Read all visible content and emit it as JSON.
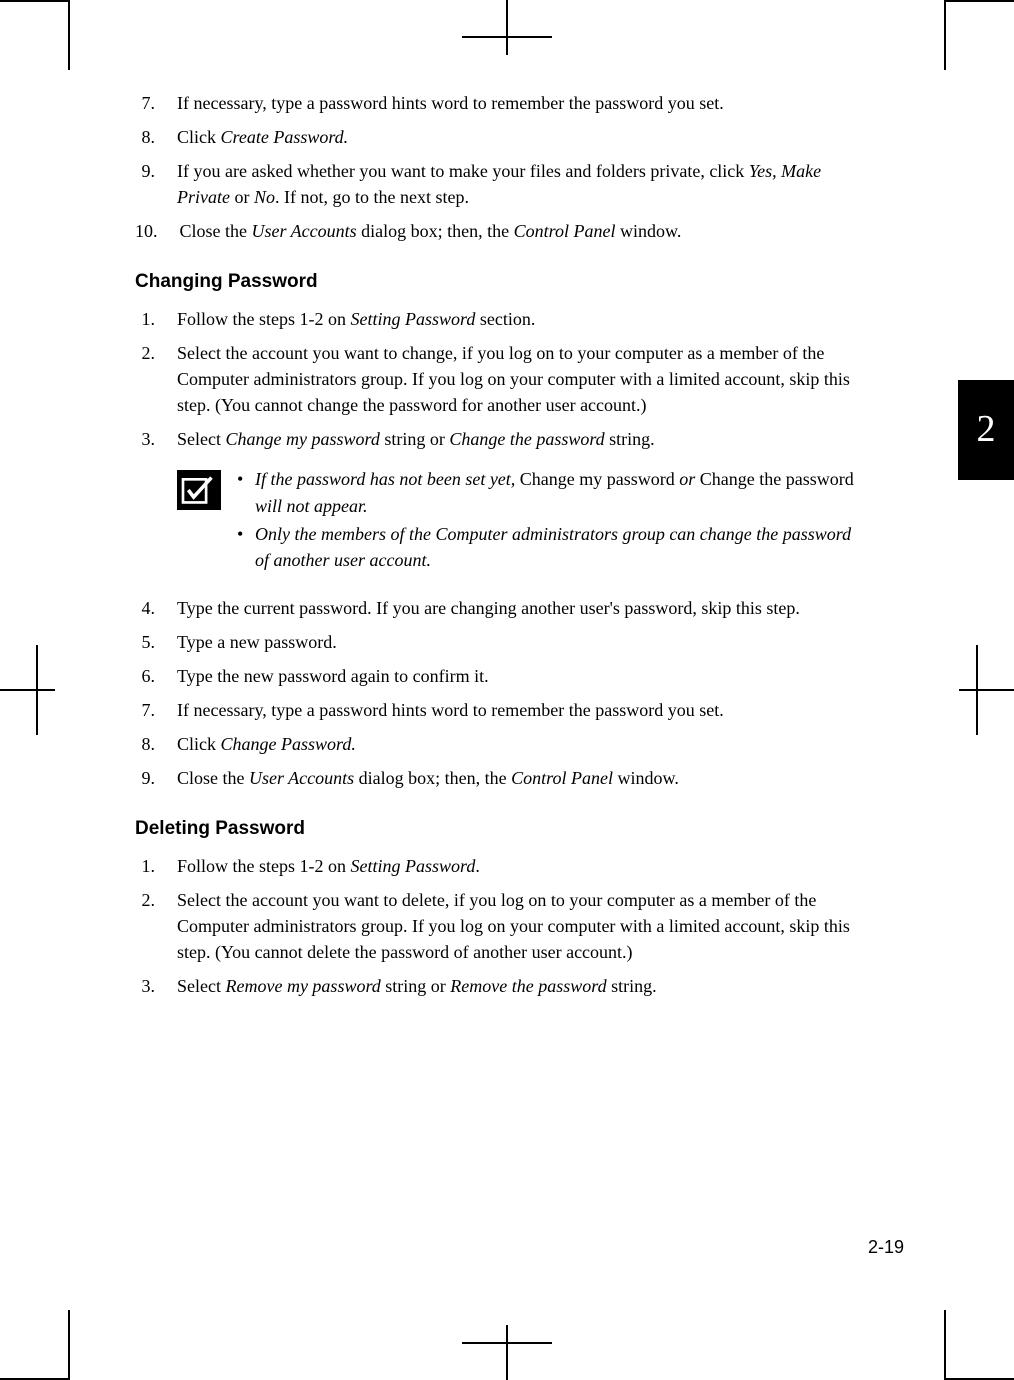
{
  "tab_number": "2",
  "page_number": "2-19",
  "section1": {
    "items": [
      {
        "n": "7.",
        "runs": [
          {
            "t": "If necessary, type a password hints word to remember the password you set."
          }
        ]
      },
      {
        "n": "8.",
        "runs": [
          {
            "t": "Click "
          },
          {
            "t": "Create Password.",
            "i": true
          }
        ]
      },
      {
        "n": "9.",
        "runs": [
          {
            "t": "If you are asked whether you want to make your files and folders private, click "
          },
          {
            "t": "Yes, Make Private",
            "i": true
          },
          {
            "t": " or "
          },
          {
            "t": "No",
            "i": true
          },
          {
            "t": ". If not, go to the next step."
          }
        ]
      },
      {
        "n": "10.",
        "runs": [
          {
            "t": "Close the "
          },
          {
            "t": "User Accounts",
            "i": true
          },
          {
            "t": " dialog box; then, the "
          },
          {
            "t": "Control Panel",
            "i": true
          },
          {
            "t": " window."
          }
        ]
      }
    ]
  },
  "section2": {
    "heading": "Changing Password",
    "items_a": [
      {
        "n": "1.",
        "runs": [
          {
            "t": "Follow the steps 1-2 on "
          },
          {
            "t": "Setting Password",
            "i": true
          },
          {
            "t": " section."
          }
        ]
      },
      {
        "n": "2.",
        "runs": [
          {
            "t": "Select the account you want to change, if you log on to your computer as a member of the Computer administrators group.  If you log on your computer with a limited account, skip this step. (You cannot change the password for another user account.)"
          }
        ]
      },
      {
        "n": "3.",
        "runs": [
          {
            "t": "Select "
          },
          {
            "t": "Change my password",
            "i": true
          },
          {
            "t": " string or "
          },
          {
            "t": "Change the password",
            "i": true
          },
          {
            "t": " string."
          }
        ]
      }
    ],
    "note": [
      {
        "runs": [
          {
            "t": "If the password has not been set yet, ",
            "i": true
          },
          {
            "t": "Change my password"
          },
          {
            "t": " or ",
            "i": true
          },
          {
            "t": "Change the password"
          },
          {
            "t": " will not appear.",
            "i": true
          }
        ]
      },
      {
        "runs": [
          {
            "t": "Only the members of the Computer administrators group can change the password of another user account.",
            "i": true
          }
        ]
      }
    ],
    "items_b": [
      {
        "n": "4.",
        "runs": [
          {
            "t": "Type the current password. If you are changing another user's password, skip this step."
          }
        ]
      },
      {
        "n": "5.",
        "runs": [
          {
            "t": "Type a new password."
          }
        ]
      },
      {
        "n": "6.",
        "runs": [
          {
            "t": "Type the new password again to confirm it."
          }
        ]
      },
      {
        "n": "7.",
        "runs": [
          {
            "t": "If necessary, type a password hints word to remember the password you set."
          }
        ]
      },
      {
        "n": "8.",
        "runs": [
          {
            "t": "Click "
          },
          {
            "t": "Change Password.",
            "i": true
          }
        ]
      },
      {
        "n": "9.",
        "runs": [
          {
            "t": "Close the "
          },
          {
            "t": "User Accounts",
            "i": true
          },
          {
            "t": " dialog box; then, the "
          },
          {
            "t": "Control Panel",
            "i": true
          },
          {
            "t": " window."
          }
        ]
      }
    ]
  },
  "section3": {
    "heading": "Deleting Password",
    "items": [
      {
        "n": "1.",
        "runs": [
          {
            "t": "Follow the steps 1-2 on "
          },
          {
            "t": "Setting Password",
            "i": true
          },
          {
            "t": "."
          }
        ]
      },
      {
        "n": "2.",
        "runs": [
          {
            "t": "Select the account you want to delete, if you log on to your computer as a member of the Computer administrators group.  If you log on your computer with a limited account, skip this step. (You cannot delete the password of another user account.)"
          }
        ]
      },
      {
        "n": "3.",
        "runs": [
          {
            "t": "Select "
          },
          {
            "t": "Remove my password",
            "i": true
          },
          {
            "t": " string or "
          },
          {
            "t": "Remove the password",
            "i": true
          },
          {
            "t": " string."
          }
        ]
      }
    ]
  }
}
